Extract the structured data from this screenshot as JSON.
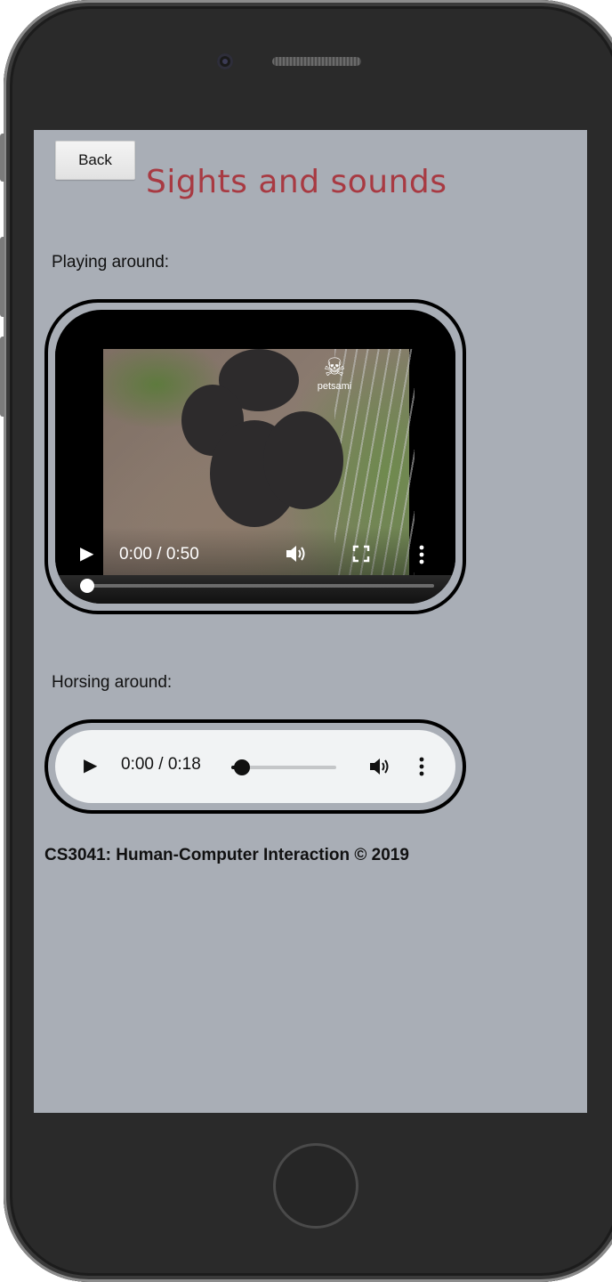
{
  "nav": {
    "back_label": "Back"
  },
  "page": {
    "title": "Sights and sounds",
    "title_color": "#a83a42",
    "background_color": "#a9aeb6"
  },
  "video_section": {
    "label": "Playing around:",
    "watermark": "petsami",
    "time": "0:00 / 0:50",
    "progress": 0.02,
    "icons": [
      "play-icon",
      "volume-icon",
      "fullscreen-icon",
      "more-options-icon"
    ]
  },
  "audio_section": {
    "label": "Horsing around:",
    "time": "0:00 / 0:18",
    "progress": 0.1,
    "icons": [
      "play-icon",
      "volume-icon",
      "more-options-icon"
    ]
  },
  "footer": {
    "text": "CS3041: Human-Computer Interaction © 2019"
  }
}
